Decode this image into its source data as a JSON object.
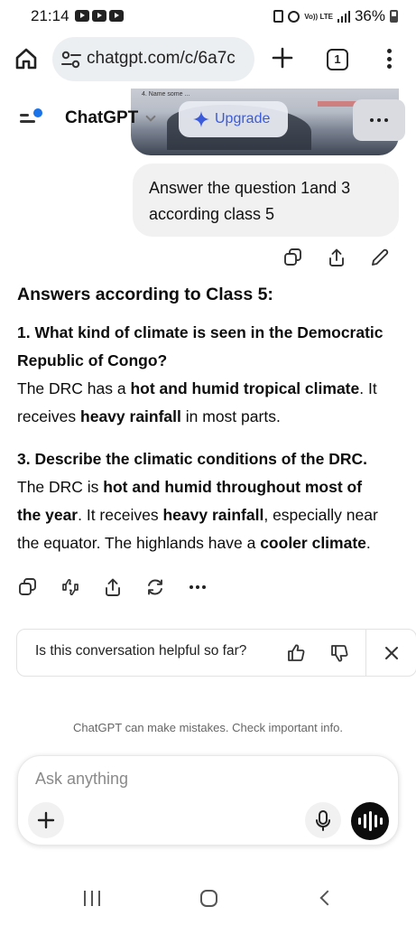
{
  "status_bar": {
    "time": "21:14",
    "volte": "Vo)) LTE",
    "network": "LTE",
    "battery": "36%"
  },
  "browser": {
    "url": "chatgpt.com/c/6a7c",
    "tab_count": "1",
    "icons": [
      "home-icon",
      "site-settings-icon",
      "new-tab-icon",
      "tab-switcher-icon",
      "browser-menu-icon"
    ]
  },
  "header": {
    "model_name": "ChatGPT",
    "upgrade_label": "Upgrade"
  },
  "attachment": {
    "visible_text": "4.   Name some ..."
  },
  "user_message": {
    "line1": "Answer the question 1and 3",
    "line2": "according class 5"
  },
  "answer": {
    "title": "Answers according to Class 5:",
    "q1": {
      "question_line1": "1. What kind of climate is seen in the Democratic",
      "question_line2": "Republic of Congo?",
      "a_pre": "The DRC has a ",
      "a_bold1": "hot and humid tropical climate",
      "a_mid1": ". It",
      "a_line2_pre": "receives ",
      "a_bold2": "heavy rainfall",
      "a_end": " in most parts."
    },
    "q3": {
      "question": "3. Describe the climatic conditions of the DRC.",
      "l1_pre": "The DRC is ",
      "l1_bold": "hot and humid throughout most of",
      "l2_bold": "the year",
      "l2_mid": ". It receives ",
      "l2_bold2": "heavy rainfall",
      "l2_end": ", especially near",
      "l3_pre": "the equator. The highlands have a ",
      "l3_bold": "cooler climate",
      "l3_end": "."
    }
  },
  "feedback": {
    "question": "Is this conversation helpful so far?"
  },
  "disclaimer": "ChatGPT can make mistakes. Check important info.",
  "composer": {
    "placeholder": "Ask anything"
  },
  "colors": {
    "accent_blue": "#1a73e8",
    "upgrade_text": "#3b5bdb",
    "voice_button": "#0d0d0d"
  }
}
